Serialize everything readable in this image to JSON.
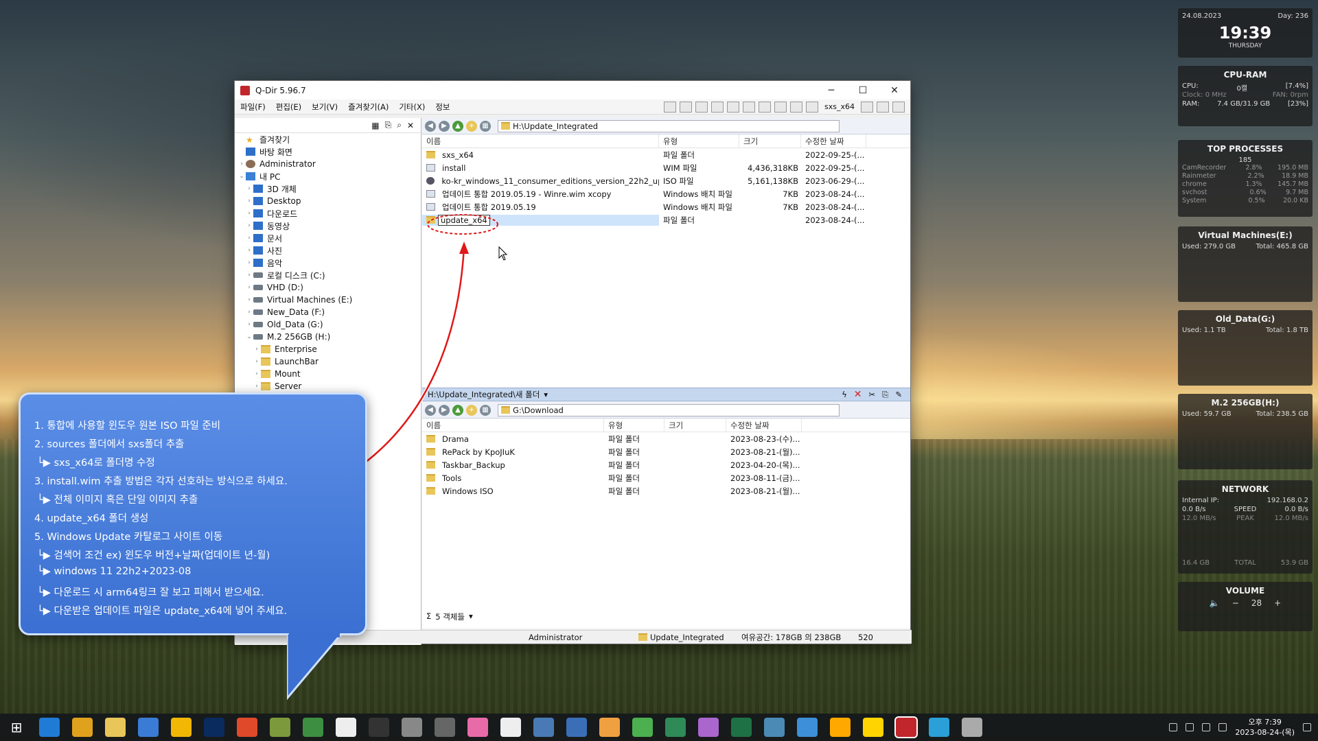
{
  "window": {
    "title": "Q-Dir 5.96.7",
    "min": "─",
    "max": "☐",
    "close": "✕"
  },
  "menu": [
    "파일(F)",
    "편집(E)",
    "보기(V)",
    "즐겨찾기(A)",
    "기타(X)",
    "정보"
  ],
  "toolbar": {
    "label": "sxs_x64"
  },
  "tree": [
    {
      "label": "즐겨찾기",
      "indent": 0,
      "exp": "",
      "icon": "star"
    },
    {
      "label": "바탕 화면",
      "indent": 0,
      "exp": "",
      "icon": "blue"
    },
    {
      "label": "Administrator",
      "indent": 0,
      "exp": "›",
      "icon": "user"
    },
    {
      "label": "내 PC",
      "indent": 0,
      "exp": "⌄",
      "icon": "pc"
    },
    {
      "label": "3D 개체",
      "indent": 1,
      "exp": "›",
      "icon": "blue"
    },
    {
      "label": "Desktop",
      "indent": 1,
      "exp": "›",
      "icon": "blue"
    },
    {
      "label": "다운로드",
      "indent": 1,
      "exp": "›",
      "icon": "blue"
    },
    {
      "label": "동영상",
      "indent": 1,
      "exp": "›",
      "icon": "blue"
    },
    {
      "label": "문서",
      "indent": 1,
      "exp": "›",
      "icon": "blue"
    },
    {
      "label": "사진",
      "indent": 1,
      "exp": "›",
      "icon": "blue"
    },
    {
      "label": "음악",
      "indent": 1,
      "exp": "›",
      "icon": "blue"
    },
    {
      "label": "로컬 디스크 (C:)",
      "indent": 1,
      "exp": "›",
      "icon": "drive"
    },
    {
      "label": "VHD (D:)",
      "indent": 1,
      "exp": "›",
      "icon": "drive"
    },
    {
      "label": "Virtual Machines (E:)",
      "indent": 1,
      "exp": "›",
      "icon": "drive"
    },
    {
      "label": "New_Data (F:)",
      "indent": 1,
      "exp": "›",
      "icon": "drive"
    },
    {
      "label": "Old_Data (G:)",
      "indent": 1,
      "exp": "›",
      "icon": "drive"
    },
    {
      "label": "M.2 256GB (H:)",
      "indent": 1,
      "exp": "⌄",
      "icon": "drive"
    },
    {
      "label": "Enterprise",
      "indent": 2,
      "exp": "›",
      "icon": "folder"
    },
    {
      "label": "LaunchBar",
      "indent": 2,
      "exp": "›",
      "icon": "folder"
    },
    {
      "label": "Mount",
      "indent": 2,
      "exp": "›",
      "icon": "folder"
    },
    {
      "label": "Server",
      "indent": 2,
      "exp": "›",
      "icon": "folder"
    }
  ],
  "top_pane": {
    "path": "H:\\Update_Integrated",
    "columns": [
      "이름",
      "유형",
      "크기",
      "수정한 날짜"
    ],
    "rows": [
      {
        "name": "sxs_x64",
        "type": "파일 폴더",
        "size": "",
        "date": "2022-09-25-(...",
        "icon": "folder"
      },
      {
        "name": "install",
        "type": "WIM 파일",
        "size": "4,436,318KB",
        "date": "2022-09-25-(...",
        "icon": "file"
      },
      {
        "name": "ko-kr_windows_11_consumer_editions_version_22h2_upda...",
        "type": "ISO 파일",
        "size": "5,161,138KB",
        "date": "2023-06-29-(...",
        "icon": "iso"
      },
      {
        "name": "업데이트 통합 2019.05.19 - Winre.wim xcopy",
        "type": "Windows 배치 파일",
        "size": "7KB",
        "date": "2023-08-24-(...",
        "icon": "file"
      },
      {
        "name": "업데이트 통합 2019.05.19",
        "type": "Windows 배치 파일",
        "size": "7KB",
        "date": "2023-08-24-(...",
        "icon": "file"
      },
      {
        "name": "update_x64",
        "type": "파일 폴더",
        "size": "",
        "date": "2023-08-24-(...",
        "icon": "folder"
      }
    ]
  },
  "mid_path": "H:\\Update_Integrated\\새 폴더",
  "bottom_pane": {
    "path": "G:\\Download",
    "columns": [
      "이름",
      "유형",
      "크기",
      "수정한 날짜"
    ],
    "rows": [
      {
        "name": "Drama",
        "type": "파일 폴더",
        "date": "2023-08-23-(수)..."
      },
      {
        "name": "RePack by KpoJIuK",
        "type": "파일 폴더",
        "date": "2023-08-21-(월)..."
      },
      {
        "name": "Taskbar_Backup",
        "type": "파일 폴더",
        "date": "2023-04-20-(목)..."
      },
      {
        "name": "Tools",
        "type": "파일 폴더",
        "date": "2023-08-11-(금)..."
      },
      {
        "name": "Windows ISO",
        "type": "파일 폴더",
        "date": "2023-08-21-(월)..."
      }
    ],
    "count": "5 객체들"
  },
  "status": {
    "user": "Administrator",
    "folder": "Update_Integrated",
    "space": "여유공간: 178GB 의 238GB",
    "num": "520"
  },
  "callout": [
    "1. 통합에 사용할 윈도우 원본 ISO 파일 준비",
    "2. sources 폴더에서 sxs폴더 추출",
    "  └▶ sxs_x64로 폴더명 수정",
    "3. install.wim 추출 방법은 각자 선호하는 방식으로 하세요.",
    "  └▶ 전체 이미지 혹은 단일 이미지 추출",
    "4. update_x64 폴더 생성",
    "5. Windows Update 카탈로그 사이트 이동",
    "  └▶ 검색어 조건 ex) 윈도우 버전+날짜(업데이트 년-월)",
    "  └▶ windows 11 22h2+2023-08",
    "  └▶ 다운로드 시 arm64링크 잘 보고 피해서 받으세요.",
    "  └▶ 다운받은 업데이트 파일은 update_x64에 넣어 주세요."
  ],
  "gadgets": {
    "clock": {
      "date": "24.08.2023",
      "day": "Day: 236",
      "time": "19:39",
      "weekday": "THURSDAY"
    },
    "cpu": {
      "title": "CPU-RAM",
      "cpu_label": "CPU:",
      "cpu_val": "0캘",
      "cpu_pct": "[7.4%]",
      "clock": "Clock: 0 MHz",
      "fan": "FAN: 0rpm",
      "ram_label": "RAM:",
      "ram_val": "7.4 GB/31.9 GB",
      "ram_pct": "[23%]"
    },
    "top": {
      "title": "TOP PROCESSES",
      "count": "185",
      "procs": [
        {
          "n": "CamRecorder",
          "p": "2.8%",
          "m": "195.0 MB"
        },
        {
          "n": "Rainmeter",
          "p": "2.2%",
          "m": "18.9 MB"
        },
        {
          "n": "chrome",
          "p": "1.3%",
          "m": "145.7 MB"
        },
        {
          "n": "svchost",
          "p": "0.6%",
          "m": "9.7 MB"
        },
        {
          "n": "System",
          "p": "0.5%",
          "m": "20.0 KB"
        }
      ]
    },
    "disks": [
      {
        "title": "Virtual Machines(E:)",
        "used": "Used: 279.0 GB",
        "total": "Total: 465.8 GB"
      },
      {
        "title": "Old_Data(G:)",
        "used": "Used: 1.1 TB",
        "total": "Total: 1.8 TB"
      },
      {
        "title": "M.2 256GB(H:)",
        "used": "Used: 59.7 GB",
        "total": "Total: 238.5 GB"
      }
    ],
    "network": {
      "title": "NETWORK",
      "ip_label": "Internal IP:",
      "ip": "192.168.0.2",
      "down": "0.0 B/s",
      "up": "0.0 B/s",
      "speed": "SPEED",
      "peak": "PEAK",
      "peak_down": "12.0 MB/s",
      "peak_up": "12.0 MB/s",
      "total_down": "16.4 GB",
      "total": "TOTAL",
      "total_up": "53.9 GB"
    },
    "volume": {
      "title": "VOLUME",
      "value": "28"
    }
  },
  "taskbar": {
    "time": "오후 7:39",
    "date": "2023-08-24-(목)"
  },
  "colors": {
    "accent": "#3b6fd1",
    "arrow": "#e01818"
  }
}
